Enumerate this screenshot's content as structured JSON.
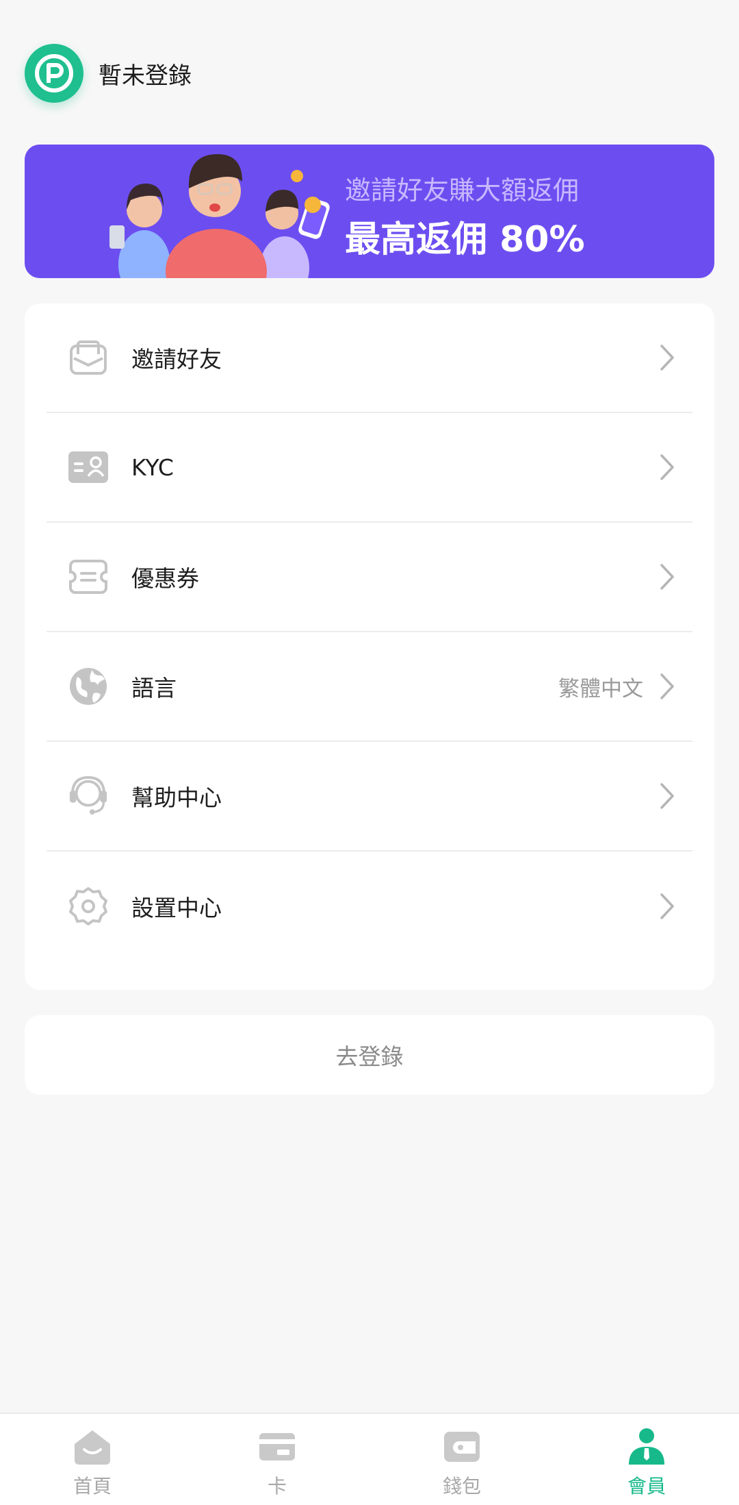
{
  "header": {
    "login_status": "暫未登錄"
  },
  "banner": {
    "subtitle": "邀請好友賺大額返佣",
    "headline": "最高返佣 80%"
  },
  "menu": {
    "items": [
      {
        "icon": "envelope-icon",
        "label": "邀請好友",
        "value": ""
      },
      {
        "icon": "id-card-icon",
        "label": "KYC",
        "value": ""
      },
      {
        "icon": "coupon-icon",
        "label": "優惠券",
        "value": ""
      },
      {
        "icon": "globe-icon",
        "label": "語言",
        "value": "繁體中文"
      },
      {
        "icon": "headset-icon",
        "label": "幫助中心",
        "value": ""
      },
      {
        "icon": "gear-icon",
        "label": "設置中心",
        "value": ""
      }
    ]
  },
  "login_button": {
    "label": "去登錄"
  },
  "tabbar": {
    "tabs": [
      {
        "icon": "home-icon",
        "label": "首頁",
        "active": false
      },
      {
        "icon": "card-icon",
        "label": "卡",
        "active": false
      },
      {
        "icon": "wallet-icon",
        "label": "錢包",
        "active": false
      },
      {
        "icon": "member-icon",
        "label": "會員",
        "active": true
      }
    ]
  },
  "colors": {
    "accent": "#17b98a",
    "banner": "#6c4ef0",
    "background": "#f7f7f7"
  }
}
